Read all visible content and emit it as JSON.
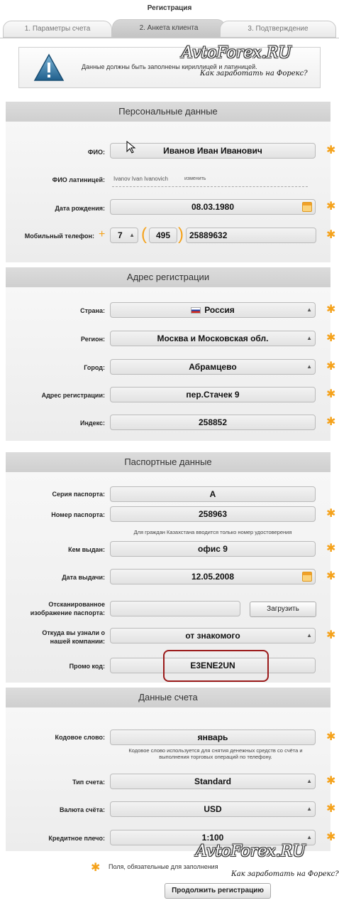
{
  "page_title": "Регистрация",
  "tabs": [
    {
      "label": "1. Параметры счета",
      "active": false
    },
    {
      "label": "2. Анкета клиента",
      "active": true
    },
    {
      "label": "3. Подтверждение",
      "active": false
    }
  ],
  "notice": {
    "text": "Данные должны быть заполнены кириллицей и латиницей.",
    "icon": "warning-triangle-icon"
  },
  "watermark": {
    "title": "AvtoForex.RU",
    "subtitle": "Как заработать на Форекс?"
  },
  "personal": {
    "header": "Персональные данные",
    "fio_label": "ФИО:",
    "fio_value": "Иванов Иван Иванович",
    "fio_latin_label": "ФИО латиницей:",
    "fio_latin_value": "Ivanov Ivan Ivanovich",
    "fio_latin_edit": "изменить",
    "birth_label": "Дата рождения:",
    "birth_value": "08.03.1980",
    "phone_label": "Мобильный телефон:",
    "phone_plus": "+",
    "phone_country": "7",
    "phone_code": "495",
    "phone_number": "25889632"
  },
  "address": {
    "header": "Адрес регистрации",
    "country_label": "Страна:",
    "country_value": "Россия",
    "region_label": "Регион:",
    "region_value": "Москва и Московская обл.",
    "city_label": "Город:",
    "city_value": "Абрамцево",
    "street_label": "Адрес регистрации:",
    "street_value": "пер.Стачек 9",
    "zip_label": "Индекс:",
    "zip_value": "258852"
  },
  "passport": {
    "header": "Паспортные данные",
    "series_label": "Серия паспорта:",
    "series_value": "А",
    "number_label": "Номер паспорта:",
    "number_value": "258963",
    "number_hint": "Для граждан Казахстана вводится только номер удостоверения",
    "issued_label": "Кем выдан:",
    "issued_value": "офис 9",
    "date_label": "Дата выдачи:",
    "date_value": "12.05.2008",
    "scan_label_1": "Отсканированное",
    "scan_label_2": "изображение паспорта:",
    "upload_button": "Загрузить",
    "source_label_1": "Откуда вы узнали о",
    "source_label_2": "нашей компании:",
    "source_value": "от знакомого",
    "promo_label": "Промо код:",
    "promo_value": "E3ENE2UN"
  },
  "account": {
    "header": "Данные счета",
    "codeword_label": "Кодовое слово:",
    "codeword_value": "январь",
    "codeword_hint_1": "Кодовое слово используется для снятия денежных средств со счёта и",
    "codeword_hint_2": "выполнения торговых операций по телефону.",
    "type_label": "Тип счета:",
    "type_value": "Standard",
    "currency_label": "Валюта счёта:",
    "currency_value": "USD",
    "leverage_label": "Кредитное плечо:",
    "leverage_value": "1:100"
  },
  "footer": {
    "required_note": "Поля, обязательные для заполнения",
    "continue_button": "Продолжить регистрацию"
  },
  "colors": {
    "star": "#f5a21b",
    "promo_border": "#9b1a1a"
  }
}
